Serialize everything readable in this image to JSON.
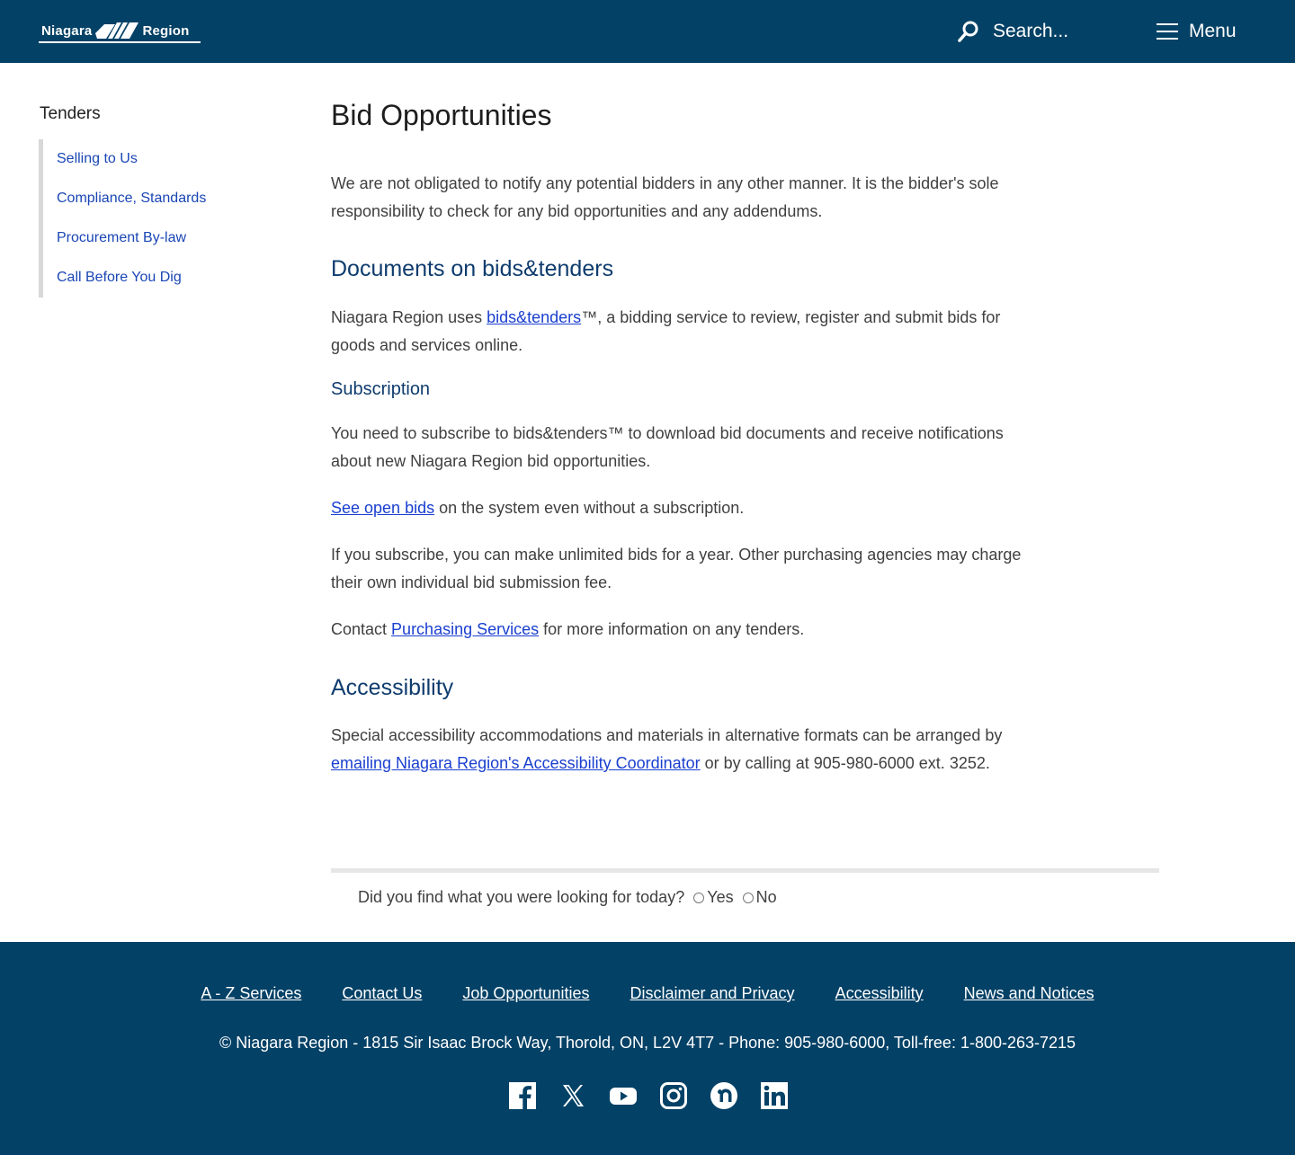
{
  "header": {
    "logo_left": "Niagara",
    "logo_right": "Region",
    "search_placeholder": "Search...",
    "menu_label": "Menu"
  },
  "sidebar": {
    "title": "Tenders",
    "items": [
      {
        "label": "Selling to Us"
      },
      {
        "label": "Compliance, Standards"
      },
      {
        "label": "Procurement By-law"
      },
      {
        "label": "Call Before You Dig"
      }
    ]
  },
  "main": {
    "title": "Bid Opportunities",
    "intro": "We are not obligated to notify any potential bidders in any other manner. It is the bidder's sole responsibility to check for any bid opportunities and any addendums.",
    "docs_heading": "Documents on bids&tenders",
    "docs_pre": "Niagara Region uses ",
    "docs_link": "bids&tenders",
    "docs_post": "™, a bidding service to review, register and submit bids for goods and services online.",
    "sub_heading": "Subscription",
    "sub_p1": "You need to subscribe to bids&tenders™ to download bid documents and receive notifications about new Niagara Region bid opportunities.",
    "open_link": "See open bids",
    "open_post": " on the system even without a subscription.",
    "sub_p3": "If you subscribe, you can make unlimited bids for a year. Other purchasing agencies may charge their own individual bid submission fee.",
    "contact_pre": "Contact ",
    "contact_link": "Purchasing Services",
    "contact_post": " for more information on any tenders.",
    "acc_heading": "Accessibility",
    "acc_pre": "Special accessibility accommodations and materials in alternative formats can be arranged by ",
    "acc_link": "emailing Niagara Region's Accessibility Coordinator",
    "acc_post": " or by calling at 905-980-6000 ext. 3252."
  },
  "feedback": {
    "question": "Did you find what you were looking for today?",
    "yes": "Yes",
    "no": "No"
  },
  "footer": {
    "links": [
      {
        "label": "A - Z Services"
      },
      {
        "label": "Contact Us"
      },
      {
        "label": "Job Opportunities"
      },
      {
        "label": "Disclaimer and Privacy"
      },
      {
        "label": "Accessibility"
      },
      {
        "label": "News and Notices"
      }
    ],
    "address": "© Niagara Region - 1815 Sir Isaac Brock Way, Thorold, ON, L2V 4T7 - Phone: 905-980-6000, Toll-free: 1-800-263-7215",
    "social": [
      "facebook-icon",
      "x-icon",
      "youtube-icon",
      "instagram-icon",
      "nextdoor-icon",
      "linkedin-icon"
    ]
  },
  "colors": {
    "brand": "#044166",
    "heading": "#0f3c6e",
    "link": "#1a3fcf"
  }
}
